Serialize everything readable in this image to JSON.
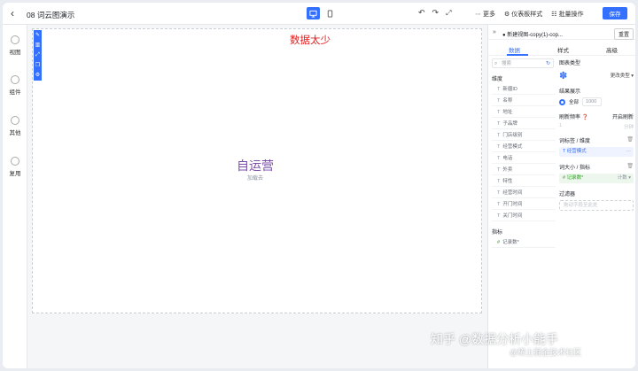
{
  "header": {
    "title": "08 词云图演示",
    "undo_icon": "undo-icon",
    "redo_icon": "redo-icon",
    "expand_icon": "expand-icon",
    "more_label": "更多",
    "dashboard_style_label": "仪表板样式",
    "batch_label": "批量操作",
    "save_label": "保存"
  },
  "rail": {
    "items": [
      {
        "label": "视图",
        "icon": "view-icon"
      },
      {
        "label": "组件",
        "icon": "component-icon"
      },
      {
        "label": "其他",
        "icon": "other-icon"
      },
      {
        "label": "复用",
        "icon": "reuse-icon"
      }
    ]
  },
  "canvas": {
    "warning": "数据太少",
    "word": "自运营",
    "hint": "加载去"
  },
  "panel": {
    "view_name": "新建视图-copy(1)-cop...",
    "reset_label": "重置",
    "tabs": [
      "数据",
      "样式",
      "高级"
    ],
    "search_placeholder": "搜索",
    "dimension_title": "维度",
    "dimensions": [
      "新疆ID",
      "名称",
      "地址",
      "子品牌",
      "门店级别",
      "经营模式",
      "电话",
      "外卖",
      "特性",
      "经营时间",
      "开门时间",
      "关门时间"
    ],
    "measure_title": "指标",
    "measures": [
      "记录数*"
    ],
    "chart_type_title": "图表类型",
    "switch_type_label": "更改类型",
    "result_title": "结果展示",
    "result_all": "全部",
    "result_limit": "1000",
    "refresh_title": "刷新频率",
    "auto_refresh_title": "开启刷新",
    "refresh_value": "1",
    "refresh_unit": "分钟",
    "word_label_title": "词标签 / 维度",
    "word_label_field": "经营模式",
    "word_size_title": "词大小 / 指标",
    "word_size_field": "记录数*",
    "word_size_agg": "计数",
    "filter_title": "过滤器",
    "filter_placeholder": "拖动字段至此处"
  },
  "watermark": {
    "line1": "知乎 @数据分析小能手",
    "line2": "@稀土掘金技术社区"
  },
  "colors": {
    "accent": "#3370ff",
    "warning": "#e02020",
    "word": "#7b4fa8"
  }
}
